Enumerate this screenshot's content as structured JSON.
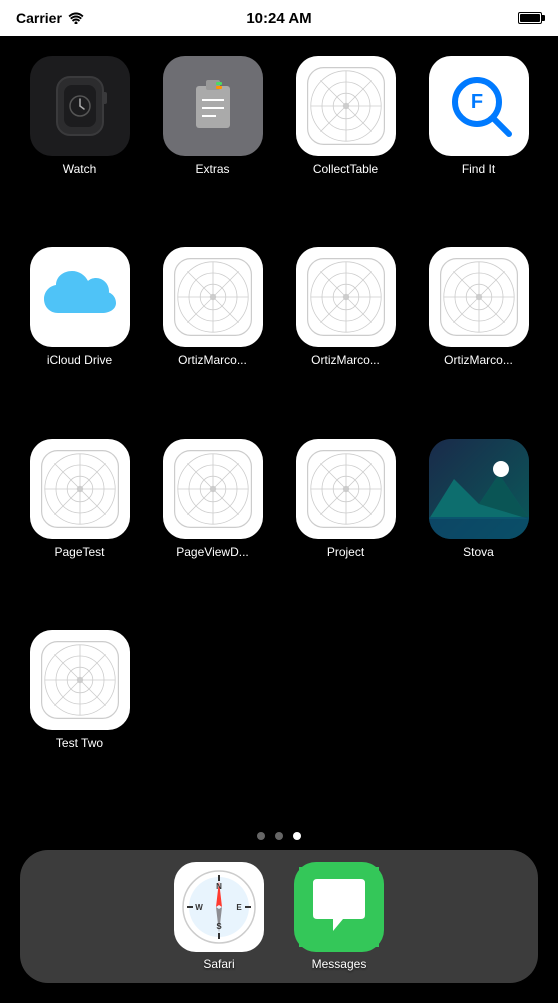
{
  "statusBar": {
    "carrier": "Carrier",
    "time": "10:24 AM",
    "batteryFull": true
  },
  "apps": [
    {
      "id": "watch",
      "label": "Watch",
      "iconType": "watch"
    },
    {
      "id": "extras",
      "label": "Extras",
      "iconType": "extras"
    },
    {
      "id": "collecttable",
      "label": "CollectTable",
      "iconType": "template"
    },
    {
      "id": "findit",
      "label": "Find It",
      "iconType": "findit"
    },
    {
      "id": "icloud",
      "label": "iCloud Drive",
      "iconType": "icloud"
    },
    {
      "id": "ortizmarco1",
      "label": "OrtizMarco...",
      "iconType": "template"
    },
    {
      "id": "ortizmarco2",
      "label": "OrtizMarco...",
      "iconType": "template"
    },
    {
      "id": "ortizmarco3",
      "label": "OrtizMarco...",
      "iconType": "template"
    },
    {
      "id": "pagetest",
      "label": "PageTest",
      "iconType": "template"
    },
    {
      "id": "pageviewd",
      "label": "PageViewD...",
      "iconType": "template"
    },
    {
      "id": "project",
      "label": "Project",
      "iconType": "template"
    },
    {
      "id": "stova",
      "label": "Stova",
      "iconType": "stova"
    },
    {
      "id": "testtwo",
      "label": "Test Two",
      "iconType": "template"
    }
  ],
  "pageDots": [
    {
      "id": "dot1",
      "active": false
    },
    {
      "id": "dot2",
      "active": false
    },
    {
      "id": "dot3",
      "active": true
    }
  ],
  "dock": [
    {
      "id": "safari",
      "label": "Safari",
      "iconType": "safari"
    },
    {
      "id": "messages",
      "label": "Messages",
      "iconType": "messages"
    }
  ]
}
